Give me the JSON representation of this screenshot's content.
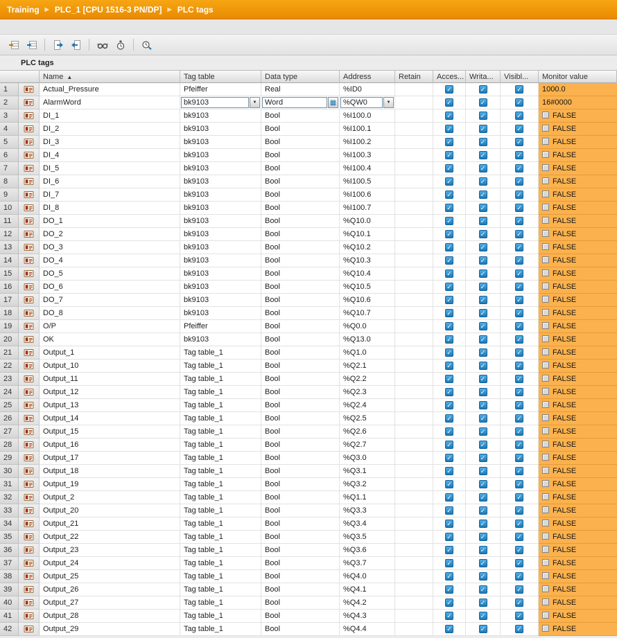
{
  "breadcrumb": {
    "items": [
      "Training",
      "PLC_1 [CPU 1516-3 PN/DP]",
      "PLC tags"
    ]
  },
  "glyphs": {
    "separator": "▶",
    "sort_asc": "▲",
    "check": "✓",
    "dropdown": "▼",
    "browse": "▦"
  },
  "toolbar": {
    "icons": [
      "insert-row-icon",
      "add-row-icon",
      "export-icon",
      "import-icon",
      "monitor-all-icon",
      "snapshot-icon",
      "retain-values-icon"
    ]
  },
  "section": {
    "title": "PLC tags"
  },
  "table": {
    "headers": [
      "Name",
      "Tag table",
      "Data type",
      "Address",
      "Retain",
      "Acces...",
      "Writa...",
      "Visibl...",
      "Monitor value"
    ],
    "checkbox_columns": {
      "retain": false,
      "accessible": true,
      "writable": true,
      "visible": true
    },
    "rows": [
      {
        "num": 1,
        "name": "Actual_Pressure",
        "tag_table": "Pfeiffer",
        "data_type": "Real",
        "address": "%ID0",
        "monitor": "1000.0",
        "bool": false
      },
      {
        "num": 2,
        "name": "AlarmWord",
        "tag_table": "bk9103",
        "data_type": "Word",
        "address": "%QW0",
        "monitor": "16#0000",
        "bool": false,
        "selected": true
      },
      {
        "num": 3,
        "name": "DI_1",
        "tag_table": "bk9103",
        "data_type": "Bool",
        "address": "%I100.0",
        "monitor": "FALSE",
        "bool": true
      },
      {
        "num": 4,
        "name": "DI_2",
        "tag_table": "bk9103",
        "data_type": "Bool",
        "address": "%I100.1",
        "monitor": "FALSE",
        "bool": true
      },
      {
        "num": 5,
        "name": "DI_3",
        "tag_table": "bk9103",
        "data_type": "Bool",
        "address": "%I100.2",
        "monitor": "FALSE",
        "bool": true
      },
      {
        "num": 6,
        "name": "DI_4",
        "tag_table": "bk9103",
        "data_type": "Bool",
        "address": "%I100.3",
        "monitor": "FALSE",
        "bool": true
      },
      {
        "num": 7,
        "name": "DI_5",
        "tag_table": "bk9103",
        "data_type": "Bool",
        "address": "%I100.4",
        "monitor": "FALSE",
        "bool": true
      },
      {
        "num": 8,
        "name": "DI_6",
        "tag_table": "bk9103",
        "data_type": "Bool",
        "address": "%I100.5",
        "monitor": "FALSE",
        "bool": true
      },
      {
        "num": 9,
        "name": "DI_7",
        "tag_table": "bk9103",
        "data_type": "Bool",
        "address": "%I100.6",
        "monitor": "FALSE",
        "bool": true
      },
      {
        "num": 10,
        "name": "DI_8",
        "tag_table": "bk9103",
        "data_type": "Bool",
        "address": "%I100.7",
        "monitor": "FALSE",
        "bool": true
      },
      {
        "num": 11,
        "name": "DO_1",
        "tag_table": "bk9103",
        "data_type": "Bool",
        "address": "%Q10.0",
        "monitor": "FALSE",
        "bool": true
      },
      {
        "num": 12,
        "name": "DO_2",
        "tag_table": "bk9103",
        "data_type": "Bool",
        "address": "%Q10.1",
        "monitor": "FALSE",
        "bool": true
      },
      {
        "num": 13,
        "name": "DO_3",
        "tag_table": "bk9103",
        "data_type": "Bool",
        "address": "%Q10.2",
        "monitor": "FALSE",
        "bool": true
      },
      {
        "num": 14,
        "name": "DO_4",
        "tag_table": "bk9103",
        "data_type": "Bool",
        "address": "%Q10.3",
        "monitor": "FALSE",
        "bool": true
      },
      {
        "num": 15,
        "name": "DO_5",
        "tag_table": "bk9103",
        "data_type": "Bool",
        "address": "%Q10.4",
        "monitor": "FALSE",
        "bool": true
      },
      {
        "num": 16,
        "name": "DO_6",
        "tag_table": "bk9103",
        "data_type": "Bool",
        "address": "%Q10.5",
        "monitor": "FALSE",
        "bool": true
      },
      {
        "num": 17,
        "name": "DO_7",
        "tag_table": "bk9103",
        "data_type": "Bool",
        "address": "%Q10.6",
        "monitor": "FALSE",
        "bool": true
      },
      {
        "num": 18,
        "name": "DO_8",
        "tag_table": "bk9103",
        "data_type": "Bool",
        "address": "%Q10.7",
        "monitor": "FALSE",
        "bool": true
      },
      {
        "num": 19,
        "name": "O/P",
        "tag_table": "Pfeiffer",
        "data_type": "Bool",
        "address": "%Q0.0",
        "monitor": "FALSE",
        "bool": true
      },
      {
        "num": 20,
        "name": "OK",
        "tag_table": "bk9103",
        "data_type": "Bool",
        "address": "%Q13.0",
        "monitor": "FALSE",
        "bool": true
      },
      {
        "num": 21,
        "name": "Output_1",
        "tag_table": "Tag table_1",
        "data_type": "Bool",
        "address": "%Q1.0",
        "monitor": "FALSE",
        "bool": true
      },
      {
        "num": 22,
        "name": "Output_10",
        "tag_table": "Tag table_1",
        "data_type": "Bool",
        "address": "%Q2.1",
        "monitor": "FALSE",
        "bool": true
      },
      {
        "num": 23,
        "name": "Output_11",
        "tag_table": "Tag table_1",
        "data_type": "Bool",
        "address": "%Q2.2",
        "monitor": "FALSE",
        "bool": true
      },
      {
        "num": 24,
        "name": "Output_12",
        "tag_table": "Tag table_1",
        "data_type": "Bool",
        "address": "%Q2.3",
        "monitor": "FALSE",
        "bool": true
      },
      {
        "num": 25,
        "name": "Output_13",
        "tag_table": "Tag table_1",
        "data_type": "Bool",
        "address": "%Q2.4",
        "monitor": "FALSE",
        "bool": true
      },
      {
        "num": 26,
        "name": "Output_14",
        "tag_table": "Tag table_1",
        "data_type": "Bool",
        "address": "%Q2.5",
        "monitor": "FALSE",
        "bool": true
      },
      {
        "num": 27,
        "name": "Output_15",
        "tag_table": "Tag table_1",
        "data_type": "Bool",
        "address": "%Q2.6",
        "monitor": "FALSE",
        "bool": true
      },
      {
        "num": 28,
        "name": "Output_16",
        "tag_table": "Tag table_1",
        "data_type": "Bool",
        "address": "%Q2.7",
        "monitor": "FALSE",
        "bool": true
      },
      {
        "num": 29,
        "name": "Output_17",
        "tag_table": "Tag table_1",
        "data_type": "Bool",
        "address": "%Q3.0",
        "monitor": "FALSE",
        "bool": true
      },
      {
        "num": 30,
        "name": "Output_18",
        "tag_table": "Tag table_1",
        "data_type": "Bool",
        "address": "%Q3.1",
        "monitor": "FALSE",
        "bool": true
      },
      {
        "num": 31,
        "name": "Output_19",
        "tag_table": "Tag table_1",
        "data_type": "Bool",
        "address": "%Q3.2",
        "monitor": "FALSE",
        "bool": true
      },
      {
        "num": 32,
        "name": "Output_2",
        "tag_table": "Tag table_1",
        "data_type": "Bool",
        "address": "%Q1.1",
        "monitor": "FALSE",
        "bool": true
      },
      {
        "num": 33,
        "name": "Output_20",
        "tag_table": "Tag table_1",
        "data_type": "Bool",
        "address": "%Q3.3",
        "monitor": "FALSE",
        "bool": true
      },
      {
        "num": 34,
        "name": "Output_21",
        "tag_table": "Tag table_1",
        "data_type": "Bool",
        "address": "%Q3.4",
        "monitor": "FALSE",
        "bool": true
      },
      {
        "num": 35,
        "name": "Output_22",
        "tag_table": "Tag table_1",
        "data_type": "Bool",
        "address": "%Q3.5",
        "monitor": "FALSE",
        "bool": true
      },
      {
        "num": 36,
        "name": "Output_23",
        "tag_table": "Tag table_1",
        "data_type": "Bool",
        "address": "%Q3.6",
        "monitor": "FALSE",
        "bool": true
      },
      {
        "num": 37,
        "name": "Output_24",
        "tag_table": "Tag table_1",
        "data_type": "Bool",
        "address": "%Q3.7",
        "monitor": "FALSE",
        "bool": true
      },
      {
        "num": 38,
        "name": "Output_25",
        "tag_table": "Tag table_1",
        "data_type": "Bool",
        "address": "%Q4.0",
        "monitor": "FALSE",
        "bool": true
      },
      {
        "num": 39,
        "name": "Output_26",
        "tag_table": "Tag table_1",
        "data_type": "Bool",
        "address": "%Q4.1",
        "monitor": "FALSE",
        "bool": true
      },
      {
        "num": 40,
        "name": "Output_27",
        "tag_table": "Tag table_1",
        "data_type": "Bool",
        "address": "%Q4.2",
        "monitor": "FALSE",
        "bool": true
      },
      {
        "num": 41,
        "name": "Output_28",
        "tag_table": "Tag table_1",
        "data_type": "Bool",
        "address": "%Q4.3",
        "monitor": "FALSE",
        "bool": true
      },
      {
        "num": 42,
        "name": "Output_29",
        "tag_table": "Tag table_1",
        "data_type": "Bool",
        "address": "%Q4.4",
        "monitor": "FALSE",
        "bool": true
      }
    ]
  }
}
